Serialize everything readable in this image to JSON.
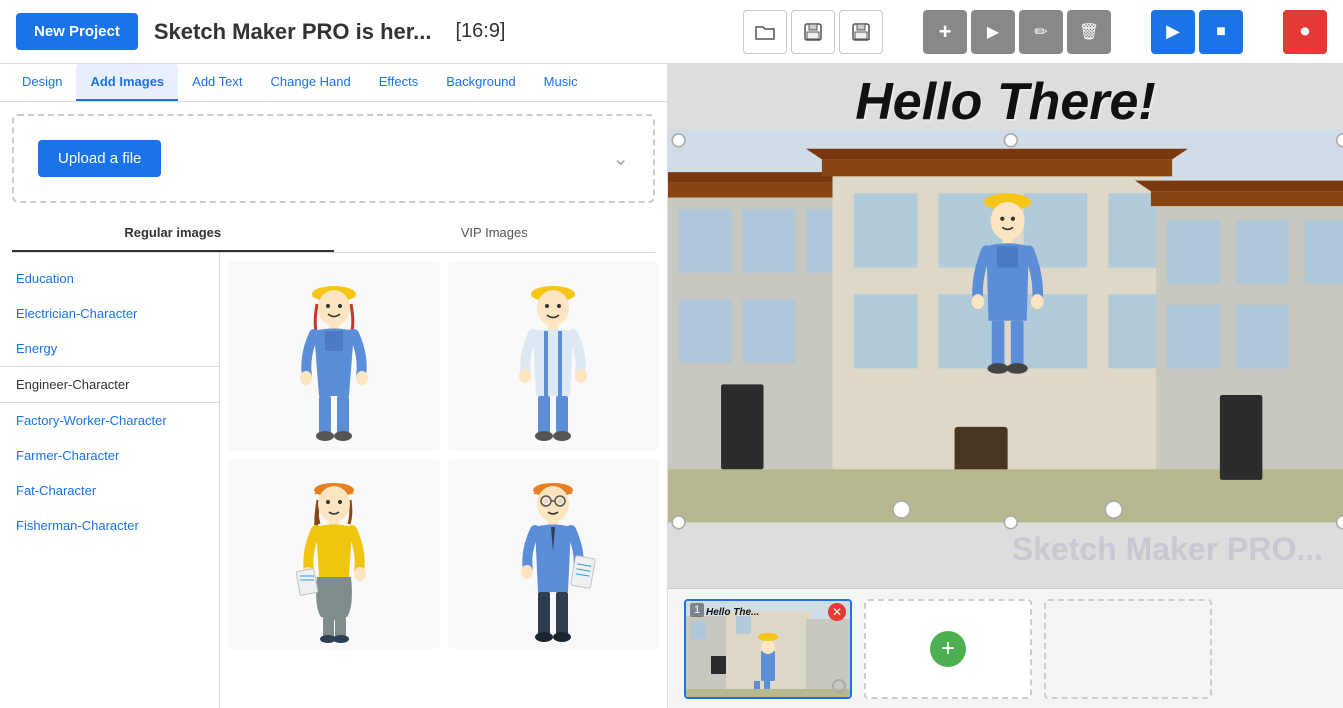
{
  "header": {
    "new_project_label": "New Project",
    "project_title": "Sketch Maker PRO is her...",
    "aspect_ratio": "[16:9]"
  },
  "toolbar": {
    "buttons": [
      {
        "id": "folder",
        "icon": "📂",
        "group": "files"
      },
      {
        "id": "save",
        "icon": "💾",
        "group": "files"
      },
      {
        "id": "save-as",
        "icon": "💾…",
        "group": "files"
      },
      {
        "id": "add",
        "icon": "+",
        "group": "edit"
      },
      {
        "id": "play-media",
        "icon": "▶",
        "group": "edit"
      },
      {
        "id": "draw",
        "icon": "✏",
        "group": "edit"
      },
      {
        "id": "delete",
        "icon": "🗑",
        "group": "edit"
      },
      {
        "id": "play",
        "icon": "▶",
        "group": "playback"
      },
      {
        "id": "stop",
        "icon": "■",
        "group": "playback"
      },
      {
        "id": "record",
        "icon": "⏺",
        "group": "record"
      }
    ]
  },
  "tabs": [
    {
      "id": "design",
      "label": "Design"
    },
    {
      "id": "add-images",
      "label": "Add Images",
      "active": true
    },
    {
      "id": "add-text",
      "label": "Add Text"
    },
    {
      "id": "change-hand",
      "label": "Change Hand"
    },
    {
      "id": "effects",
      "label": "Effects"
    },
    {
      "id": "background",
      "label": "Background"
    },
    {
      "id": "music",
      "label": "Music"
    }
  ],
  "upload": {
    "button_label": "Upload a file"
  },
  "sub_tabs": [
    {
      "id": "regular",
      "label": "Regular images",
      "active": true
    },
    {
      "id": "vip",
      "label": "VIP Images"
    }
  ],
  "categories": [
    {
      "id": "education",
      "label": "Education"
    },
    {
      "id": "electrician",
      "label": "Electrician-Character"
    },
    {
      "id": "energy",
      "label": "Energy"
    },
    {
      "id": "engineer",
      "label": "Engineer-Character",
      "selected": true
    },
    {
      "id": "factory",
      "label": "Factory-Worker-Character"
    },
    {
      "id": "farmer",
      "label": "Farmer-Character"
    },
    {
      "id": "fat",
      "label": "Fat-Character"
    },
    {
      "id": "fisherman",
      "label": "Fisherman-Character"
    }
  ],
  "scene": {
    "title": "Hello There!",
    "watermark": "Sketch Maker PRO..."
  },
  "slides": [
    {
      "id": 1,
      "num": "1",
      "title": "Hello The",
      "active": true
    },
    {
      "id": 2,
      "num": "",
      "is_add": true
    },
    {
      "id": 3,
      "num": "",
      "is_empty": true
    }
  ]
}
